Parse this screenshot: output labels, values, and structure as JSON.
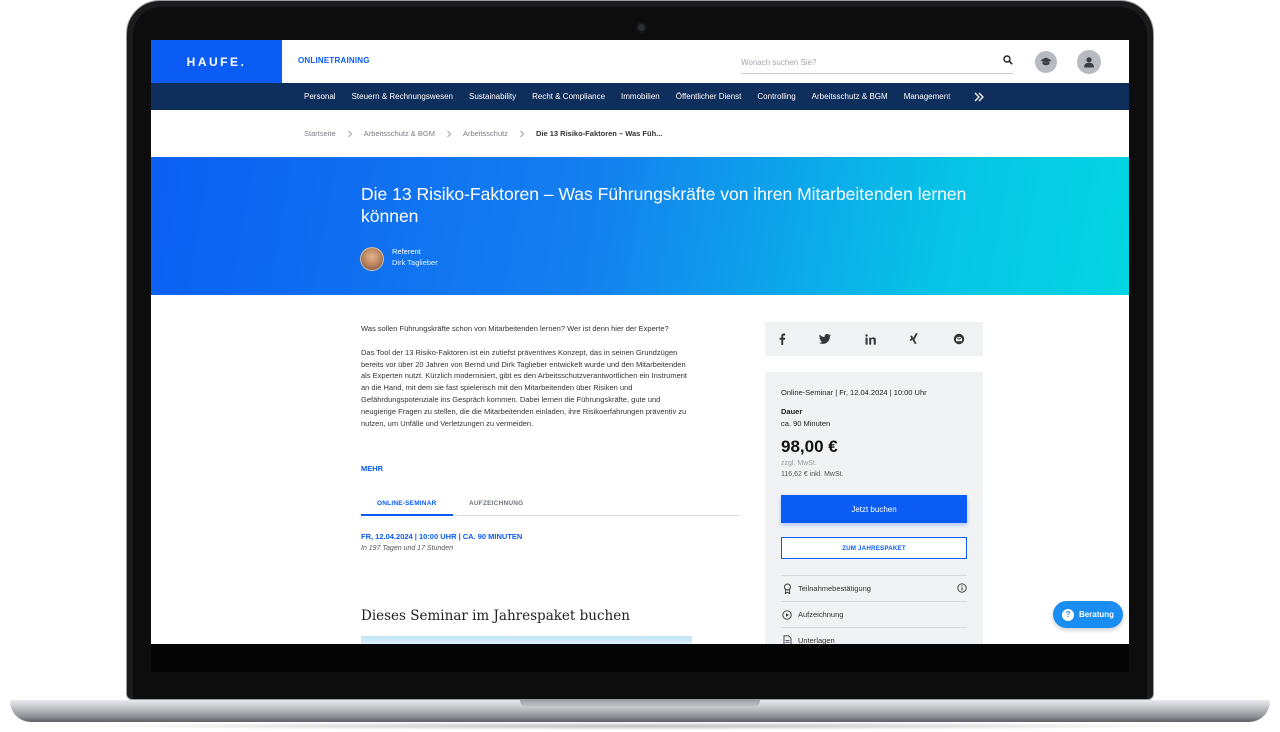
{
  "header": {
    "logo_text": "HAUFE.",
    "product_name": "ONLINETRAINING",
    "search_placeholder": "Wonach suchen Sie?",
    "icons": {
      "search": "search-icon",
      "academy": "graduation-cap-icon",
      "user": "user-icon"
    }
  },
  "nav": {
    "items": [
      "Personal",
      "Steuern & Rechnungswesen",
      "Sustainability",
      "Recht & Compliance",
      "Immobilien",
      "Öffentlicher Dienst",
      "Controlling",
      "Arbeitsschutz & BGM",
      "Management"
    ],
    "more_icon": "double-chevron-right-icon"
  },
  "breadcrumb": {
    "items": [
      "Startseite",
      "Arbeitsschutz & BGM",
      "Arbeitsschutz"
    ],
    "current": "Die 13 Risiko-Faktoren – Was Füh..."
  },
  "hero": {
    "title": "Die 13 Risiko-Faktoren – Was Führungskräfte von ihren Mitarbeitenden lernen können",
    "referent_label": "Referent",
    "referent_name": "Dirk Taglieber"
  },
  "content": {
    "intro": "Was sollen Führungskräfte schon von Mitarbeitenden lernen? Wer ist denn hier der Ex­perte?",
    "body": "Das Tool der 13 Risiko-Faktoren ist ein zutiefst präventives Konzept, das in seinen Grundzügen bereits vor über 20 Jahren von Bernd und Dirk Taglieber entwickelt wurde und den Mitarbeitenden als Experten nutzt. Kürzlich modernisiert, gibt es den Arbeits­schutzverantwortlichen ein Instrument an die Hand, mit dem sie fast spielerisch mit den Mitarbeitenden über Risiken und Gefährdungspotenziale ins Gespräch kommen. Dabei lernen die Führungskräfte, gute und neugierige Fragen zu stellen, die die Mitarbeitenden einladen, ihre Risikoerfahrungen präventiv zu nutzen, um Unfälle und Verletzungen zu vermeiden.",
    "more_link": "MEHR"
  },
  "tabs": {
    "online": "ONLINE-SEMINAR",
    "recording": "AUFZEICHNUNG"
  },
  "schedule": {
    "date_line": "FR, 12.04.2024 | 10:00 UHR | CA. 90 MINUTEN",
    "countdown": "In 197 Tagen und 17 Stunden"
  },
  "package_section": {
    "title": "Dieses Seminar im Jahrespaket buchen"
  },
  "share": {
    "icons": [
      "facebook-icon",
      "twitter-icon",
      "linkedin-icon",
      "xing-icon",
      "email-icon"
    ]
  },
  "offer": {
    "header": "Online-Seminar | Fr, 12.04.2024 | 10:00 Uhr",
    "duration_label": "Dauer",
    "duration_value": "ca. 90 Minuten",
    "price": "98,00 €",
    "vat_note": "zzgl. MwSt.",
    "gross_price": "116,62 € inkl. MwSt.",
    "book_button": "Jetzt buchen",
    "package_button": "ZUM JAHRESPAKET",
    "features": [
      {
        "label": "Teilnahmebestätigung",
        "icon": "certificate-icon",
        "info": true
      },
      {
        "label": "Aufzeichnung",
        "icon": "play-circle-icon",
        "info": false
      },
      {
        "label": "Unterlagen",
        "icon": "document-icon",
        "info": false
      }
    ]
  },
  "help": {
    "label": "Beratung",
    "icon": "question-icon"
  },
  "colors": {
    "brand_blue": "#0a5cf5",
    "nav_navy": "#0e2e5b",
    "hero_start": "#0b5ff2",
    "hero_end": "#04d6e2"
  }
}
